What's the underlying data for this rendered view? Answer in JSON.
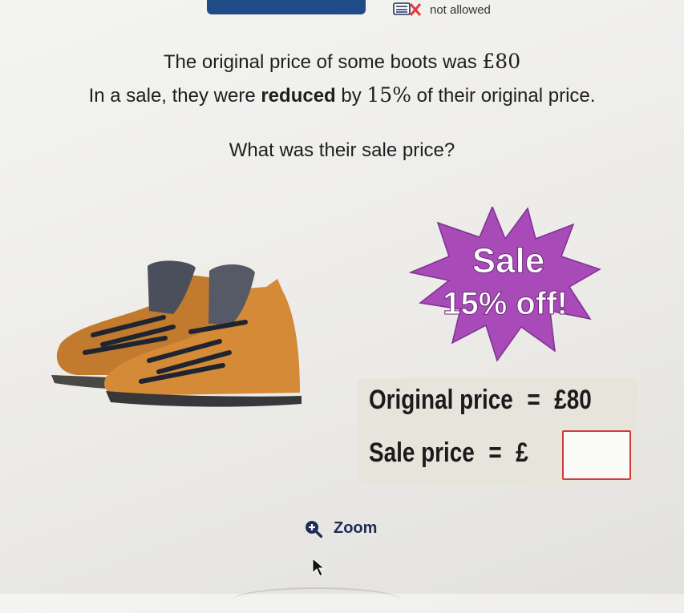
{
  "status": {
    "icon": "calculator-not-allowed-icon",
    "label": "not allowed"
  },
  "question": {
    "line1_text": "The original price of some boots was ",
    "line1_price": "£80",
    "line2_pre": "In a sale, they were ",
    "line2_bold": "reduced",
    "line2_mid": " by ",
    "line2_percent": "15%",
    "line2_post": " of their original price.",
    "line3": "What was their sale price?"
  },
  "badge": {
    "line1": "Sale",
    "line2": "15% off!",
    "color": "#a84bb8"
  },
  "prices": {
    "original_label": "Original price",
    "equals": "=",
    "original_value": "£80",
    "sale_label": "Sale price",
    "currency": "£",
    "sale_value": ""
  },
  "zoom": {
    "label": "Zoom",
    "icon": "zoom-in-icon"
  },
  "colors": {
    "answer_border": "#d23a3a",
    "panel_bg": "#e6e4db",
    "tab": "#1f4b86"
  }
}
